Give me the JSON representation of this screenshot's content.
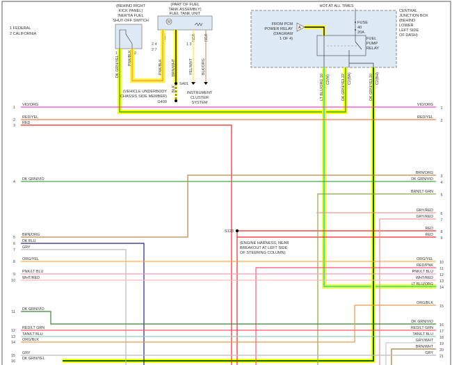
{
  "legend": {
    "item1": "1 FEDERAL",
    "item2": "2 CALIFORNIA"
  },
  "components": {
    "inertia_switch": {
      "line1": "(BEHIND RIGHT",
      "line2": "KICK PANEL)",
      "line3": "INERTIA FUEL",
      "line4": "SHUT-OFF SWITCH",
      "pin1": "1",
      "pin2": "2"
    },
    "fuel_tank_unit": {
      "line1": "(PART OF FUEL",
      "line2": "TANK ASSEMBLY)",
      "line3": "FUEL TANK UNIT",
      "motor": "M",
      "nca": "NCA"
    },
    "junction_box": {
      "hot": "HOT AT ALL TIMES",
      "line1": "CENTRAL",
      "line2": "JUNCTION BOX",
      "line3": "(BEHIND",
      "line4": "LOWER",
      "line5": "LEFT SIDE",
      "line6": "OF DASH)",
      "fuse1": "FUSE",
      "fuse2": "40",
      "fuse3": "20A",
      "relay1": "FUEL",
      "relay2": "PUMP",
      "relay3": "RELAY",
      "pcm1": "FROM PCM",
      "pcm2": "POWER RELAY",
      "pcm3": "(DIAGRAM",
      "pcm4": "1 OF 4)",
      "pcm_ref": "A"
    },
    "splice_s401": "S401",
    "ground_g400": "G400",
    "ground_note1": "(VEHICLE UNDERBODY",
    "ground_note2": "CHASSIS SIDE MEMBER)",
    "cluster1": "INSTRUMENT",
    "cluster2": "CLUSTER",
    "cluster3": "SYSTEM",
    "splice_s123": "S123",
    "s123_note1": "(ENGINE HARNESS, NEAR",
    "s123_note2": "BREAKOUT AT LEFT SIDE",
    "s123_note3": "OF STEERING COLUMN)"
  },
  "vertical_wires": {
    "dk_grn_yel": "DK GRN/YEL",
    "pnk_blk_1": "PNK/BLK",
    "pnk_blk_2": "PNK/BLK",
    "brn_wht": "BRN/WHT",
    "blk": "BLK",
    "yel_wht": "YEL/WHT",
    "blk_org": "BLK/ORG",
    "lt_blu_org": "LT BLU/ORG",
    "dk_grn_yel_2": "DK GRN/YEL",
    "dk_grn_yel_3": "DK GRN/YEL",
    "conn_a": "C2(M)",
    "conn_b": "C2(BA)",
    "conn_c": "C2(BH)",
    "pin_a": "10",
    "pin_b": "22",
    "pin_c": "10",
    "pins_fed": "2   4",
    "pins_cal": "2   7",
    "pins_cluster": "1   3"
  },
  "left_wires": [
    {
      "num": "1",
      "label": "VIO/ORG"
    },
    {
      "num": "2",
      "label": "RED/YEL"
    },
    {
      "num": "3",
      "label": "RED"
    },
    {
      "num": "4",
      "label": "DK GRN/VIO"
    },
    {
      "num": "5",
      "label": "BRN/ORG"
    },
    {
      "num": "6",
      "label": "DK BLU"
    },
    {
      "num": "7",
      "label": "GRY"
    },
    {
      "num": "8",
      "label": "ORG/YEL"
    },
    {
      "num": "9",
      "label": "PNK/LT BLU"
    },
    {
      "num": "10",
      "label": "WHT/RED"
    },
    {
      "num": "11",
      "label": "DK GRN/VIO"
    },
    {
      "num": "12",
      "label": "RED/LT GRN"
    },
    {
      "num": "13",
      "label": "TAN/LT BLU"
    },
    {
      "num": "14",
      "label": "ORG/BLK"
    },
    {
      "num": "15",
      "label": "GRY"
    },
    {
      "num": "16",
      "label": "DK GRN/YEL"
    }
  ],
  "right_wires": [
    {
      "num": "1",
      "label": "VIO/ORG"
    },
    {
      "num": "2",
      "label": "RED/YEL"
    },
    {
      "num": "3",
      "label": "BRN/ORG"
    },
    {
      "num": "4",
      "label": "DK GRN/VIO"
    },
    {
      "num": "5",
      "label": "BRN/LT GRN"
    },
    {
      "num": "6",
      "label": "GRY/RED"
    },
    {
      "num": "7",
      "label": "GRY/RED"
    },
    {
      "num": "8",
      "label": "RED"
    },
    {
      "num": "9",
      "label": "RED"
    },
    {
      "num": "10",
      "label": "ORG/YEL"
    },
    {
      "num": "11",
      "label": "RED/PNK"
    },
    {
      "num": "12",
      "label": "PNK/LT BLU"
    },
    {
      "num": "13",
      "label": "WHT/RED"
    },
    {
      "num": "14",
      "label": "LT BLU/ORG"
    },
    {
      "num": "15",
      "label": "ORG/BLK"
    },
    {
      "num": "16",
      "label": "DK GRN/VIO"
    },
    {
      "num": "17",
      "label": "RED/LT GRN"
    },
    {
      "num": "18",
      "label": "TAN/LT BLU"
    },
    {
      "num": "19",
      "label": "GRY/WHT"
    },
    {
      "num": "20",
      "label": "BRN/WHT"
    },
    {
      "num": "21",
      "label": "GRY"
    }
  ],
  "colors": {
    "highlight": "#ffff00",
    "box_fill": "#dde9f5"
  }
}
